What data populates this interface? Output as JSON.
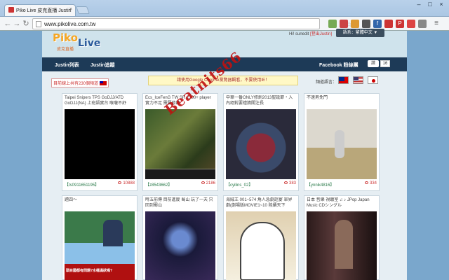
{
  "browser": {
    "tab_title": "Piko Live 皮克直播 Justin",
    "url": "www.pikolive.com.tw",
    "min_icon": "minimize-icon",
    "max_icon": "maximize-icon",
    "close_icon": "close-icon"
  },
  "header": {
    "logo_piko": "Piko",
    "logo_live": "Live",
    "logo_sub": "皮克直播",
    "user_greeting": "Hi! sunedit",
    "logout_label": "[登出Justin]",
    "lang_button": "語系：繁體中文 ▼"
  },
  "nav": {
    "items": [
      "Justin列表",
      "Justin追蹤"
    ],
    "facebook_label": "Facebook 粉絲團",
    "like_label": "讚",
    "like_count": "16"
  },
  "info": {
    "live_count": "目前線上共有230個頻道",
    "notice": "請使用Google Chrome瀏覽器觀看，不要使用IE！",
    "lang_label": "頻道語言："
  },
  "cards": [
    {
      "title": "Taipei Snipers TPS GoDJJ/ATD GoDJJ(NA) 上班語實台 喉嚨不舒",
      "channel": "【ts0911651195】",
      "views": "10888"
    },
    {
      "title": "Ecs_IceFenG TW SR 2300+ player 實力不足 需要修練",
      "channel": "【z8543662】",
      "views": "2186"
    },
    {
      "title": "中華一番ONLY修劍2013聖誕節・入內絕對要禮猜關注長",
      "channel": "【cyilins_02】",
      "views": "383"
    },
    {
      "title": "不速男免門",
      "channel": "【ynnik4816】",
      "views": "334"
    },
    {
      "title": "題四～",
      "channel": "",
      "views": ""
    },
    {
      "title": "時五前傳 目前進度 蜀山 玩了一天 只回到蜀山",
      "channel": "",
      "views": ""
    },
    {
      "title": "海賊王 001~574 角人急劇話宴 單界劇(劇場版MOVIE1~10 陸續天下",
      "channel": "",
      "views": ""
    },
    {
      "title": "日本 音樂 視聽室 ♫ ♪ JPop Japan Music CDシングル",
      "channel": "",
      "views": ""
    }
  ],
  "watermark": "Beatnits66",
  "thumb_overlay": "頭目國都有問題?水桶滿狀嗎?"
}
